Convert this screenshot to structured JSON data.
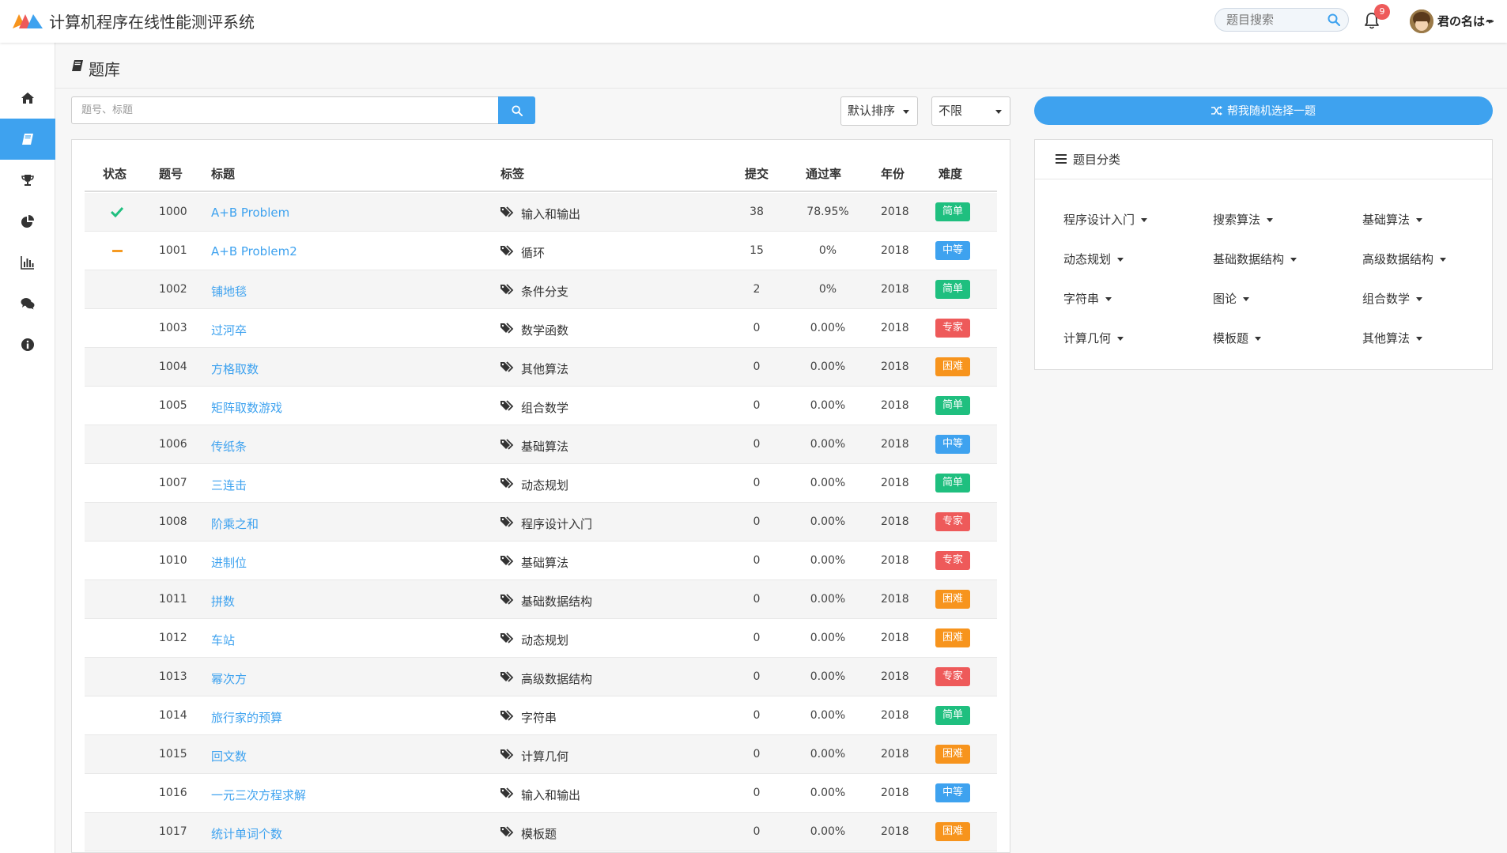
{
  "header": {
    "app_title": "计算机程序在线性能测评系统",
    "search_placeholder": "题目搜索",
    "notification_count": "9",
    "user_name": "君の名は~"
  },
  "sidebar": {
    "items": [
      {
        "name": "home-icon",
        "active": false
      },
      {
        "name": "book-icon",
        "active": true
      },
      {
        "name": "trophy-icon",
        "active": false
      },
      {
        "name": "pie-chart-icon",
        "active": false
      },
      {
        "name": "bar-chart-icon",
        "active": false
      },
      {
        "name": "comments-icon",
        "active": false
      },
      {
        "name": "info-icon",
        "active": false
      }
    ]
  },
  "page": {
    "title": "题库"
  },
  "filter": {
    "placeholder": "题号、标题",
    "sort_value": "默认排序",
    "limit_value": "不限"
  },
  "table": {
    "headers": {
      "status": "状态",
      "id": "题号",
      "title": "标题",
      "tags": "标签",
      "submit": "提交",
      "rate": "通过率",
      "year": "年份",
      "difficulty": "难度"
    },
    "rows": [
      {
        "status": "solved",
        "id": "1000",
        "title": "A+B Problem",
        "tag": "输入和输出",
        "submit": "38",
        "rate": "78.95%",
        "year": "2018",
        "difficulty": "简单"
      },
      {
        "status": "attempted",
        "id": "1001",
        "title": "A+B Problem2",
        "tag": "循环",
        "submit": "15",
        "rate": "0%",
        "year": "2018",
        "difficulty": "中等"
      },
      {
        "status": "",
        "id": "1002",
        "title": "铺地毯",
        "tag": "条件分支",
        "submit": "2",
        "rate": "0%",
        "year": "2018",
        "difficulty": "简单"
      },
      {
        "status": "",
        "id": "1003",
        "title": "过河卒",
        "tag": "数学函数",
        "submit": "0",
        "rate": "0.00%",
        "year": "2018",
        "difficulty": "专家"
      },
      {
        "status": "",
        "id": "1004",
        "title": "方格取数",
        "tag": "其他算法",
        "submit": "0",
        "rate": "0.00%",
        "year": "2018",
        "difficulty": "困难"
      },
      {
        "status": "",
        "id": "1005",
        "title": "矩阵取数游戏",
        "tag": "组合数学",
        "submit": "0",
        "rate": "0.00%",
        "year": "2018",
        "difficulty": "简单"
      },
      {
        "status": "",
        "id": "1006",
        "title": "传纸条",
        "tag": "基础算法",
        "submit": "0",
        "rate": "0.00%",
        "year": "2018",
        "difficulty": "中等"
      },
      {
        "status": "",
        "id": "1007",
        "title": "三连击",
        "tag": "动态规划",
        "submit": "0",
        "rate": "0.00%",
        "year": "2018",
        "difficulty": "简单"
      },
      {
        "status": "",
        "id": "1008",
        "title": "阶乘之和",
        "tag": "程序设计入门",
        "submit": "0",
        "rate": "0.00%",
        "year": "2018",
        "difficulty": "专家"
      },
      {
        "status": "",
        "id": "1010",
        "title": "进制位",
        "tag": "基础算法",
        "submit": "0",
        "rate": "0.00%",
        "year": "2018",
        "difficulty": "专家"
      },
      {
        "status": "",
        "id": "1011",
        "title": "拼数",
        "tag": "基础数据结构",
        "submit": "0",
        "rate": "0.00%",
        "year": "2018",
        "difficulty": "困难"
      },
      {
        "status": "",
        "id": "1012",
        "title": "车站",
        "tag": "动态规划",
        "submit": "0",
        "rate": "0.00%",
        "year": "2018",
        "difficulty": "困难"
      },
      {
        "status": "",
        "id": "1013",
        "title": "幂次方",
        "tag": "高级数据结构",
        "submit": "0",
        "rate": "0.00%",
        "year": "2018",
        "difficulty": "专家"
      },
      {
        "status": "",
        "id": "1014",
        "title": "旅行家的预算",
        "tag": "字符串",
        "submit": "0",
        "rate": "0.00%",
        "year": "2018",
        "difficulty": "简单"
      },
      {
        "status": "",
        "id": "1015",
        "title": "回文数",
        "tag": "计算几何",
        "submit": "0",
        "rate": "0.00%",
        "year": "2018",
        "difficulty": "困难"
      },
      {
        "status": "",
        "id": "1016",
        "title": "一元三次方程求解",
        "tag": "输入和输出",
        "submit": "0",
        "rate": "0.00%",
        "year": "2018",
        "difficulty": "中等"
      },
      {
        "status": "",
        "id": "1017",
        "title": "统计单词个数",
        "tag": "模板题",
        "submit": "0",
        "rate": "0.00%",
        "year": "2018",
        "difficulty": "困难"
      }
    ]
  },
  "difficulty_colors": {
    "简单": "#1fbf7f",
    "中等": "#3ea2ef",
    "困难": "#f7941d",
    "专家": "#ee5a5a"
  },
  "right_panel": {
    "random_label": "帮我随机选择一题",
    "category_title": "题目分类",
    "categories": [
      "程序设计入门",
      "搜索算法",
      "基础算法",
      "动态规划",
      "基础数据结构",
      "高级数据结构",
      "字符串",
      "图论",
      "组合数学",
      "计算几何",
      "模板题",
      "其他算法"
    ]
  }
}
